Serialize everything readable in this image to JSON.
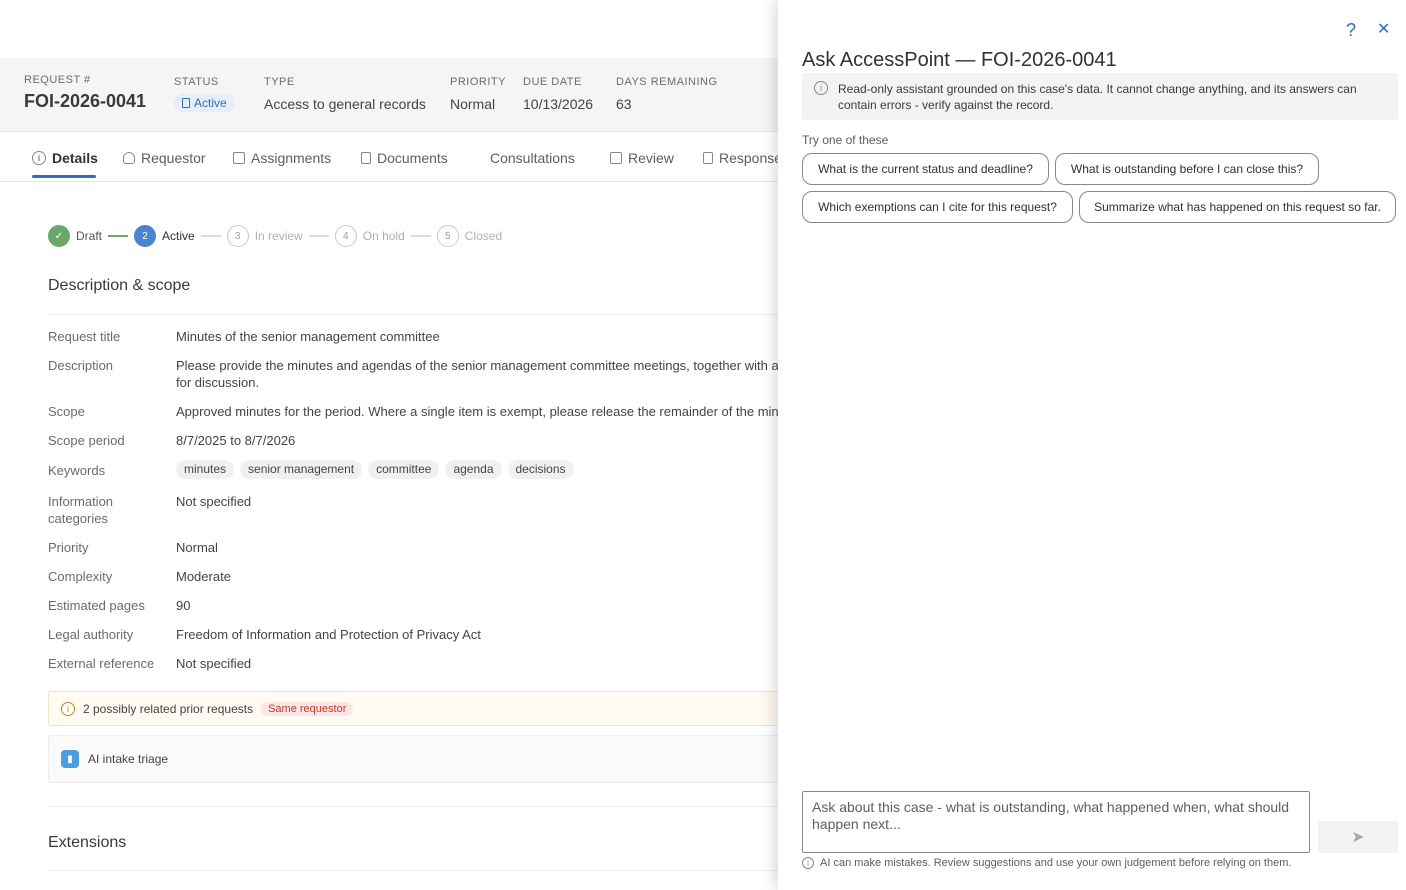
{
  "summary": {
    "request_label": "REQUEST #",
    "request_value": "FOI-2026-0041",
    "status_label": "STATUS",
    "status_value": "Active",
    "type_label": "TYPE",
    "type_value": "Access to general records",
    "priority_label": "PRIORITY",
    "priority_value": "Normal",
    "due_label": "DUE DATE",
    "due_value": "10/13/2026",
    "days_label": "DAYS REMAINING",
    "days_value": "63"
  },
  "tabs": [
    {
      "label": "Details",
      "icon": "info-icon"
    },
    {
      "label": "Requestor",
      "icon": "person-icon"
    },
    {
      "label": "Assignments",
      "icon": "assignments-icon"
    },
    {
      "label": "Documents",
      "icon": "document-icon"
    },
    {
      "label": "Consultations",
      "icon": ""
    },
    {
      "label": "Review",
      "icon": "review-icon"
    },
    {
      "label": "Response",
      "icon": "lock-icon"
    }
  ],
  "stepper": [
    {
      "num": "✓",
      "label": "Draft"
    },
    {
      "num": "2",
      "label": "Active"
    },
    {
      "num": "3",
      "label": "In review"
    },
    {
      "num": "4",
      "label": "On hold"
    },
    {
      "num": "5",
      "label": "Closed"
    }
  ],
  "details": {
    "section_title": "Description & scope",
    "rows": {
      "request_title": {
        "label": "Request title",
        "value": "Minutes of the senior management committee"
      },
      "description": {
        "label": "Description",
        "value": "Please provide the minutes and agendas of the senior management committee meetings, together with a",
        "value2": "for discussion."
      },
      "scope": {
        "label": "Scope",
        "value": "Approved minutes for the period. Where a single item is exempt, please release the remainder of the min"
      },
      "scope_period": {
        "label": "Scope period",
        "value": "8/7/2025 to 8/7/2026"
      },
      "keywords": {
        "label": "Keywords",
        "chips": [
          "minutes",
          "senior management",
          "committee",
          "agenda",
          "decisions"
        ]
      },
      "info_categories": {
        "label": "Information categories",
        "value": "Not specified"
      },
      "priority": {
        "label": "Priority",
        "value": "Normal"
      },
      "complexity": {
        "label": "Complexity",
        "value": "Moderate"
      },
      "estimated_pages": {
        "label": "Estimated pages",
        "value": "90"
      },
      "legal_authority": {
        "label": "Legal authority",
        "value": "Freedom of Information and Protection of Privacy Act"
      },
      "external_reference": {
        "label": "External reference",
        "value": "Not specified"
      }
    },
    "related_text": "2 possibly related prior requests",
    "related_badge": "Same requestor",
    "triage_label": "AI intake triage",
    "extensions_title": "Extensions"
  },
  "panel": {
    "title": "Ask AccessPoint — FOI-2026-0041",
    "help_icon": "?",
    "close_icon": "✕",
    "notice": "Read-only assistant grounded on this case's data. It cannot change anything, and its answers can contain errors - verify against the record.",
    "try_label": "Try one of these",
    "suggestions": [
      "What is the current status and deadline?",
      "What is outstanding before I can close this?",
      "Which exemptions can I cite for this request?",
      "Summarize what has happened on this request so far."
    ],
    "composer_placeholder": "Ask about this case - what is outstanding, what happened when, what should happen next...",
    "send_icon": "➤",
    "disclaimer": "AI can make mistakes. Review suggestions and use your own judgement before relying on them."
  },
  "colors": {
    "accent": "#2f6fba",
    "done": "#6aa86a",
    "current": "#4a86d0",
    "warning_badge": "#c0392b"
  }
}
